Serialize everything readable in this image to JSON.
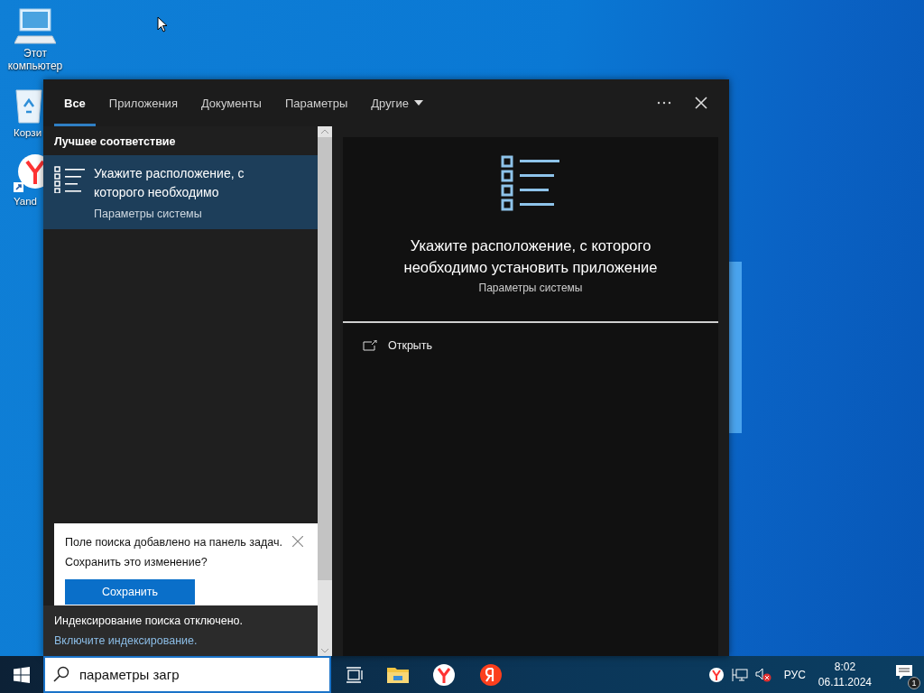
{
  "desktop_icons": [
    {
      "kind": "computer",
      "label": "Этот компьютер"
    },
    {
      "kind": "recycle",
      "label": "Корзи"
    },
    {
      "kind": "yandex",
      "label": "Yand"
    }
  ],
  "search_panel": {
    "tabs": [
      {
        "label": "Все",
        "selected": true,
        "dropdown": false
      },
      {
        "label": "Приложения",
        "selected": false,
        "dropdown": false
      },
      {
        "label": "Документы",
        "selected": false,
        "dropdown": false
      },
      {
        "label": "Параметры",
        "selected": false,
        "dropdown": false
      },
      {
        "label": "Другие",
        "selected": false,
        "dropdown": true
      }
    ],
    "section_title": "Лучшее соответствие",
    "results": [
      {
        "title": "Укажите расположение, с которого необходимо",
        "subtitle": "Параметры системы",
        "selected": true
      }
    ],
    "toast": {
      "message": [
        "Поле поиска добавлено на панель задач.",
        "Сохранить это изменение?"
      ],
      "button": "Сохранить"
    },
    "indexing_notice": {
      "text": "Индексирование поиска отключено.",
      "link": "Включите индексирование."
    },
    "preview": {
      "title": "Укажите расположение, с которого необходимо установить приложение",
      "subtitle": "Параметры системы",
      "actions": [
        {
          "label": "Открыть"
        }
      ]
    }
  },
  "taskbar": {
    "search_value": "параметры загр",
    "apps": [
      {
        "kind": "task-view"
      },
      {
        "kind": "explorer"
      },
      {
        "kind": "yandex-browser"
      },
      {
        "kind": "yandex"
      }
    ],
    "tray": [
      {
        "kind": "yandex"
      },
      {
        "kind": "network"
      },
      {
        "kind": "sound-muted"
      }
    ],
    "language": "РУС",
    "time": "8:02",
    "date": "06.11.2024",
    "notification_count": "1"
  }
}
